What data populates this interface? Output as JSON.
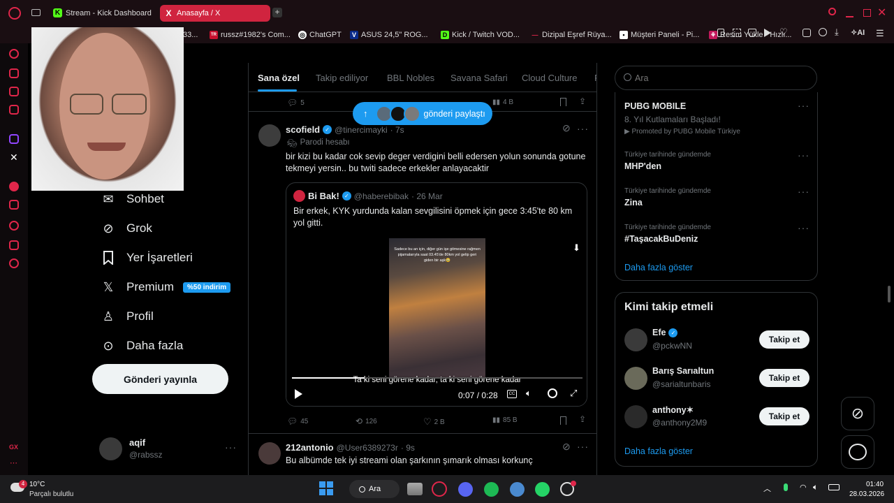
{
  "browser": {
    "tabs": [
      {
        "label": "Stream - Kick Dashboard",
        "fav": "K"
      },
      {
        "label": "Anasayfa / X",
        "fav": "X"
      }
    ],
    "new_tab": "+",
    "ai_label": "AI",
    "bookmarks": [
      {
        "label": "33...",
        "fav": ""
      },
      {
        "label": "russz#1982's Com...",
        "fav": "TR"
      },
      {
        "label": "ChatGPT",
        "fav": "◎"
      },
      {
        "label": "ASUS 24,5\" ROG...",
        "fav": "V"
      },
      {
        "label": "Kick / Twitch VOD...",
        "fav": "D"
      },
      {
        "label": "Dizipal Eşref Rüya...",
        "fav": "—"
      },
      {
        "label": "Müşteri Paneli - Pi...",
        "fav": "▪"
      },
      {
        "label": "Resim Yükle - Hızlı...",
        "fav": "⚘"
      }
    ]
  },
  "nav": {
    "items": [
      {
        "label": "Sohbet",
        "icon": "mail-icon"
      },
      {
        "label": "Grok",
        "icon": "grok-icon"
      },
      {
        "label": "Yer İşaretleri",
        "icon": "bookmark-icon"
      },
      {
        "label": "Premium",
        "icon": "x-icon",
        "badge": "%50 indirim"
      },
      {
        "label": "Profil",
        "icon": "person-icon"
      },
      {
        "label": "Daha fazla",
        "icon": "more-circle-icon"
      }
    ],
    "post_button": "Gönderi yayınla",
    "account": {
      "name": "aqif",
      "handle": "@rabssz"
    }
  },
  "timeline": {
    "tabs": [
      "Sana özel",
      "Takip ediliyor",
      "BBL Nobles",
      "Savana Safari",
      "Cloud Culture",
      "P"
    ],
    "top_stats": {
      "replies": "5",
      "views": "4 B"
    },
    "new_posts_pill": "gönderi paylaştı",
    "tweet1": {
      "name": "scofield",
      "handle": "@tinercimayki",
      "time": "· 7s",
      "label": "Parodi hesabı",
      "text": "bir kizi bu kadar cok sevip deger verdigini belli edersen yolun sonunda gotune tekmeyi yersin.. bu twiti sadece erkekler anlayacaktir",
      "quote": {
        "name": "Bi Bak!",
        "handle": "@haberebibak",
        "time": "· 26 Mar",
        "text": "Bir erkek, KYK yurdunda kalan sevgilisini öpmek için gece 3:45'te 80 km yol gitti.",
        "video_caption": "Sadece bu an için, diğer gün işe gitmesine rağmen pijamalarıyla saat 03.45'de 80km yol gelip geri giden bir aşk🥹",
        "subtitle": "Ta ki seni görene kadar, ta ki seni görene kadar",
        "time_display": "0:07 / 0:28",
        "progress": 0.25
      },
      "stats": {
        "replies": "45",
        "retweets": "126",
        "likes": "2 B",
        "views": "85 B"
      }
    },
    "tweet2": {
      "name": "212antonio",
      "handle": "@User6389273r",
      "time": "· 9s",
      "text": "Bu albümde tek iyi streami olan şarkının şımarık olması korkunç"
    }
  },
  "sidebar": {
    "search_placeholder": "Ara",
    "trends": [
      {
        "name": "PUBG MOBILE",
        "sub": "8. Yıl Kutlamaları Başladı!",
        "promo": "Promoted by PUBG Mobile Türkiye"
      },
      {
        "sub": "Türkiye tarihinde gündemde",
        "name": "MHP'den"
      },
      {
        "sub": "Türkiye tarihinde gündemde",
        "name": "Zina"
      },
      {
        "sub": "Türkiye tarihinde gündemde",
        "name": "#TaşacakBuDeniz"
      }
    ],
    "show_more": "Daha fazla göster",
    "who_to_follow": {
      "title": "Kimi takip etmeli",
      "users": [
        {
          "name": "Efe",
          "handle": "@pckwNN",
          "verified": true
        },
        {
          "name": "Barış Sarıaltun",
          "handle": "@sarialtunbaris",
          "verified": false
        },
        {
          "name": "anthony✶",
          "handle": "@anthony2M9",
          "verified": false
        }
      ],
      "follow_label": "Takip et",
      "show_more": "Daha fazla göster"
    }
  },
  "taskbar": {
    "weather_temp": "10°C",
    "weather_text": "Parçalı bulutlu",
    "weather_badge": "4",
    "search": "Ara",
    "time": "01:40",
    "date": "28.03.2026"
  },
  "colors": {
    "accent": "#1d9bf0",
    "opera": "#e0264a",
    "bg": "#000000"
  }
}
